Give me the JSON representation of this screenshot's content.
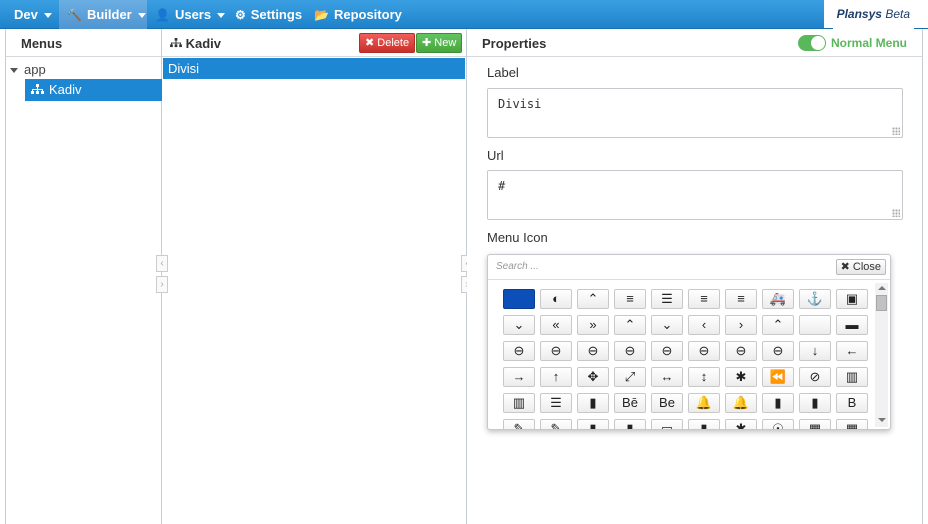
{
  "topnav": {
    "items": [
      {
        "label": "Dev",
        "icon": "caret",
        "dropdown": true
      },
      {
        "label": "Builder",
        "icon": "gavel-icon",
        "dropdown": true
      },
      {
        "label": "Users",
        "icon": "user-icon",
        "dropdown": true
      },
      {
        "label": "Settings",
        "icon": "sliders-icon",
        "dropdown": false
      },
      {
        "label": "Repository",
        "icon": "folder-open-icon",
        "dropdown": false
      }
    ],
    "brand": "Plansys",
    "brand_tag": "Beta"
  },
  "menus_panel": {
    "title": "Menus",
    "tree": {
      "root_label": "app",
      "children": [
        {
          "label": "Kadiv",
          "icon": "sitemap-icon"
        }
      ]
    }
  },
  "list_panel": {
    "title": "Kadiv",
    "delete_label": "Delete",
    "new_label": "New",
    "rows": [
      "Divisi"
    ]
  },
  "properties": {
    "title": "Properties",
    "mode_toggle_label": "Normal Menu",
    "mode_toggle_on": true,
    "label_field": {
      "label": "Label",
      "value": "Divisi"
    },
    "url_field": {
      "label": "Url",
      "value": "#"
    },
    "icon_field": {
      "label": "Menu Icon"
    }
  },
  "icon_picker": {
    "search_placeholder": "Search ...",
    "close_label": "Close",
    "selected_color": "#0c4fb8",
    "rows": [
      [
        "",
        "◐",
        "⌃",
        "≡",
        "☰",
        "≡",
        "≡",
        "🚑",
        "⚓",
        "▣"
      ],
      [
        "⌄",
        "«",
        "»",
        "⌃",
        "⌄",
        "‹",
        "›",
        "⌃",
        "",
        "▬"
      ],
      [
        "⊖",
        "⊖",
        "⊖",
        "⊖",
        "⊖",
        "⊖",
        "⊖",
        "⊖",
        "↓",
        "←"
      ],
      [
        "→",
        "↑",
        "✥",
        "⤢",
        "↔",
        "↕",
        "✱",
        "⏪",
        "⊘",
        "▥"
      ],
      [
        "▥",
        "☰",
        "▮",
        "Bē",
        "Be",
        "🔔",
        "🔔",
        "▮",
        "▮",
        "B"
      ],
      [
        "✎",
        "✎",
        "▮",
        "▮",
        "▭",
        "▮",
        "✱",
        "☉",
        "▦",
        "▦"
      ]
    ]
  }
}
